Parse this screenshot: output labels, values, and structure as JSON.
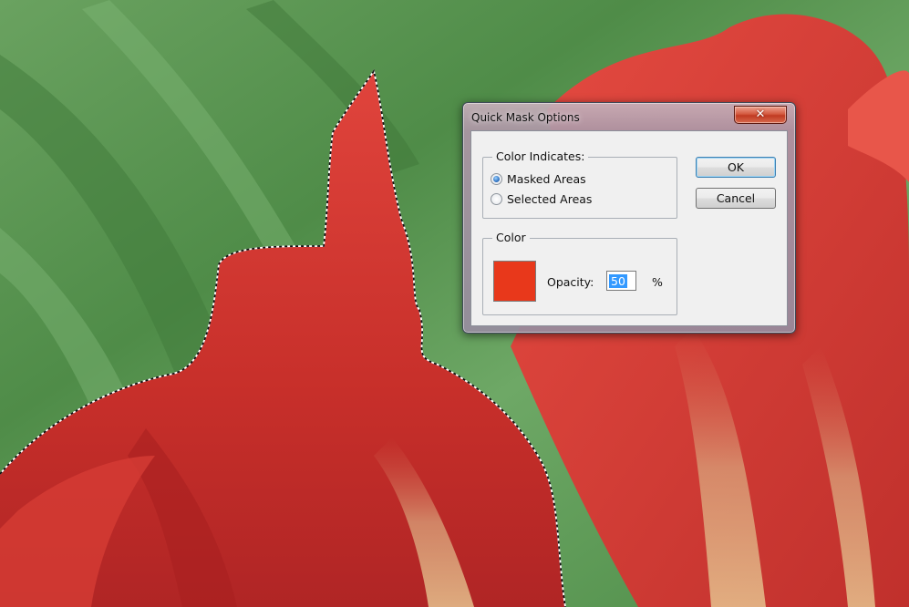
{
  "dialog": {
    "title": "Quick Mask Options",
    "close_icon": "close-x-icon",
    "color_indicates": {
      "legend": "Color Indicates:",
      "options": [
        {
          "label": "Masked Areas",
          "checked": true
        },
        {
          "label": "Selected Areas",
          "checked": false
        }
      ]
    },
    "color_group": {
      "legend": "Color",
      "swatch_color": "#e8381b",
      "opacity_label": "Opacity:",
      "opacity_value": "50",
      "percent_sign": "%"
    },
    "ok_label": "OK",
    "cancel_label": "Cancel"
  },
  "canvas": {
    "description_icon": "tulip-photo",
    "selection": "marching-ants-selection"
  }
}
